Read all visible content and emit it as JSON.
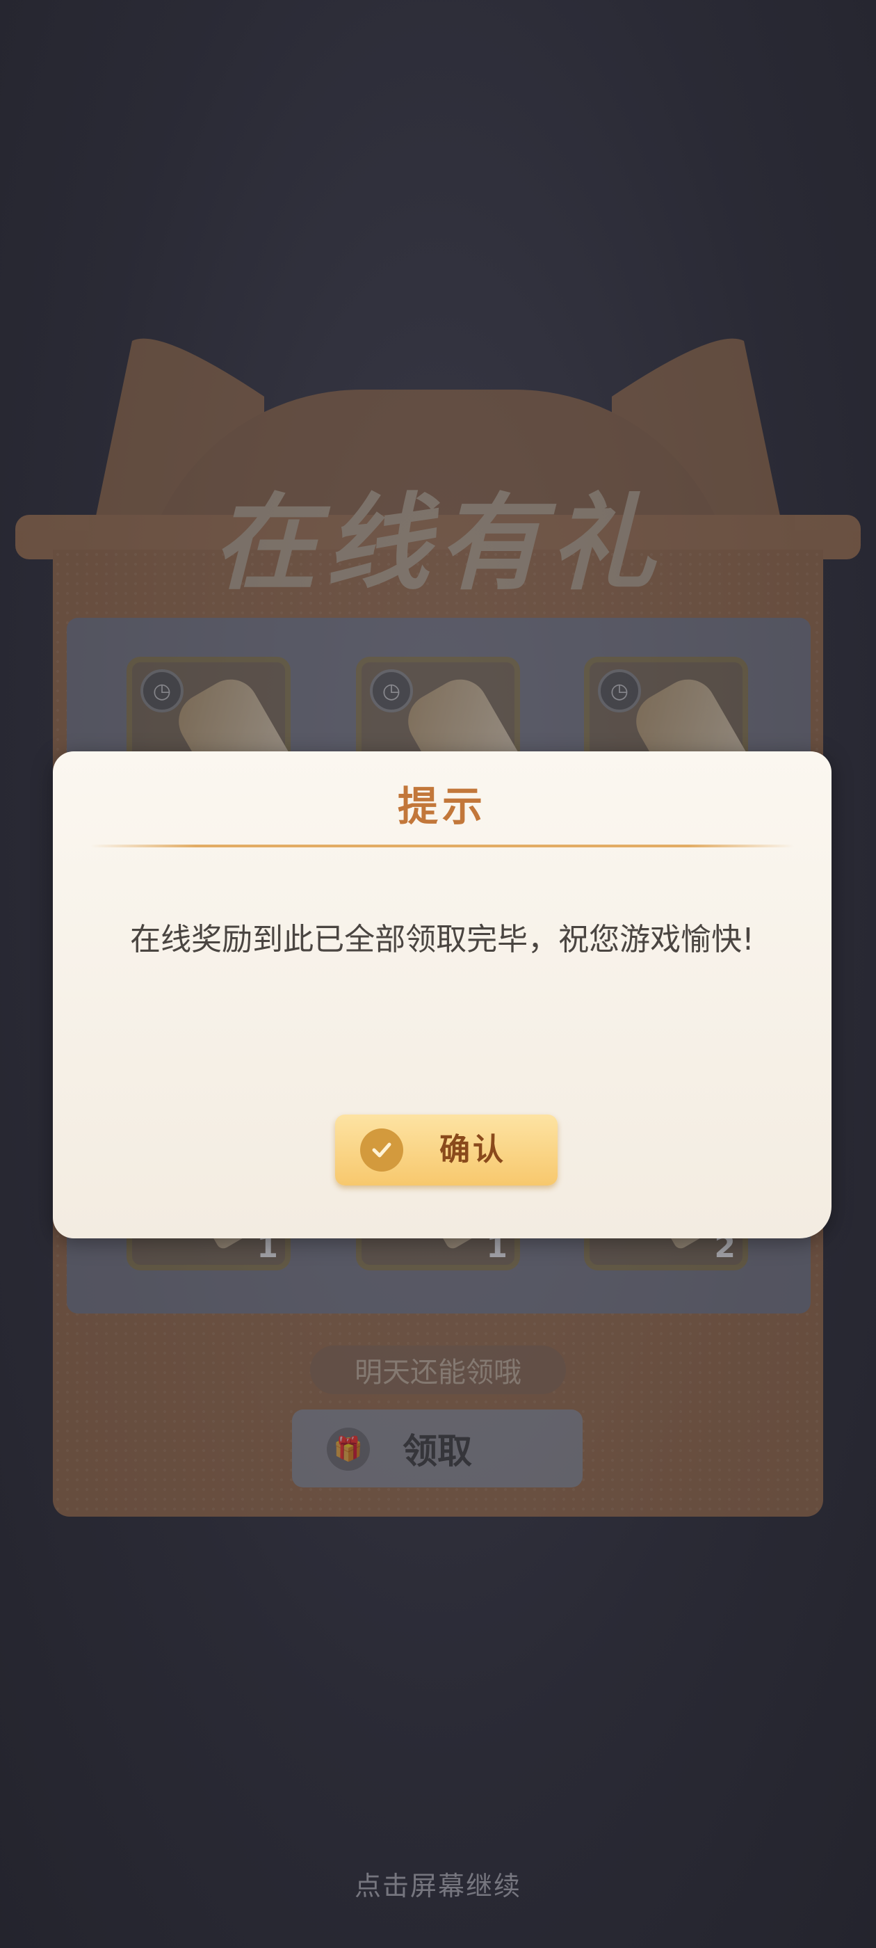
{
  "background_panel": {
    "title": "在线有礼",
    "items": [
      {
        "count": ""
      },
      {
        "count": ""
      },
      {
        "count": ""
      },
      {
        "count": ""
      },
      {
        "count": ""
      },
      {
        "count": ""
      },
      {
        "count": "1"
      },
      {
        "count": "1"
      },
      {
        "count": "2"
      }
    ],
    "tomorrow_text": "明天还能领哦",
    "claim_label": "领取"
  },
  "dialog": {
    "title": "提示",
    "message": "在线奖励到此已全部领取完毕，祝您游戏愉快!",
    "confirm_label": "确认"
  },
  "continue_hint": "点击屏幕继续",
  "colors": {
    "dialog_title": "#c2773a",
    "confirm_button": "#f7c86d",
    "confirm_text": "#8a4a1c"
  }
}
